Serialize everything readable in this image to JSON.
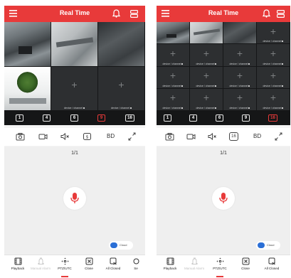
{
  "left": {
    "header": {
      "title": "Real Time"
    },
    "grid": [
      {
        "kind": "live",
        "label": "",
        "style": "cam-office"
      },
      {
        "kind": "live",
        "label": "",
        "style": "cam-bright"
      },
      {
        "kind": "live",
        "label": "",
        "style": "cam-dark"
      },
      {
        "kind": "live",
        "label": "",
        "style": "cam-plant"
      },
      {
        "kind": "empty",
        "label": "device / channel"
      },
      {
        "kind": "empty",
        "label": "device / channel"
      }
    ],
    "channels": [
      {
        "label": "1",
        "active": false
      },
      {
        "label": "4",
        "active": false
      },
      {
        "label": "6",
        "active": false
      },
      {
        "label": "9",
        "active": true
      },
      {
        "label": "16",
        "active": false
      }
    ],
    "toolbar": {
      "quality": "BD"
    },
    "page_indicator": "1/1",
    "toggle_label": "Cloud",
    "nav": [
      {
        "label": "Playback",
        "icon": "playback-icon",
        "disabled": false
      },
      {
        "label": "Manual Alarm",
        "icon": "alarm-icon",
        "disabled": true
      },
      {
        "label": "PTZ/UTC",
        "icon": "ptz-icon",
        "disabled": false
      },
      {
        "label": "Close",
        "icon": "close-icon",
        "disabled": false
      },
      {
        "label": "All Closed",
        "icon": "all-closed-icon",
        "disabled": false
      },
      {
        "label": "Se",
        "icon": "settings-icon",
        "disabled": false
      }
    ]
  },
  "right": {
    "header": {
      "title": "Real Time"
    },
    "grid": [
      {
        "kind": "live",
        "label": "",
        "style": "cam-office"
      },
      {
        "kind": "live",
        "label": "",
        "style": "cam-bright"
      },
      {
        "kind": "live",
        "label": "",
        "style": "cam-dark"
      },
      {
        "kind": "empty",
        "label": "device / channel"
      },
      {
        "kind": "empty",
        "label": "device / channel"
      },
      {
        "kind": "empty",
        "label": "device / channel"
      },
      {
        "kind": "empty",
        "label": "device / channel"
      },
      {
        "kind": "empty",
        "label": "device / channel"
      },
      {
        "kind": "empty",
        "label": "device / channel"
      },
      {
        "kind": "empty",
        "label": "device / channel"
      },
      {
        "kind": "empty",
        "label": "device / channel"
      },
      {
        "kind": "empty",
        "label": "device / channel"
      },
      {
        "kind": "empty",
        "label": "device / channel"
      },
      {
        "kind": "empty",
        "label": "device / channel"
      },
      {
        "kind": "empty",
        "label": "device / channel"
      },
      {
        "kind": "empty",
        "label": "device / channel"
      }
    ],
    "channels": [
      {
        "label": "1",
        "active": false
      },
      {
        "label": "4",
        "active": false
      },
      {
        "label": "6",
        "active": false
      },
      {
        "label": "9",
        "active": false
      },
      {
        "label": "16",
        "active": true
      }
    ],
    "toolbar": {
      "split": "16",
      "quality": "BD"
    },
    "page_indicator": "1/1",
    "toggle_label": "Cloud",
    "nav": [
      {
        "label": "Playback",
        "icon": "playback-icon",
        "disabled": false
      },
      {
        "label": "Manual Alarm",
        "icon": "alarm-icon",
        "disabled": true
      },
      {
        "label": "PTZ/UTC",
        "icon": "ptz-icon",
        "disabled": false
      },
      {
        "label": "Close",
        "icon": "close-icon",
        "disabled": false
      },
      {
        "label": "All Closed",
        "icon": "all-closed-icon",
        "disabled": false
      }
    ]
  },
  "colors": {
    "accent": "#e83a3a",
    "toggle": "#2b6fd6",
    "mic": "#e83a3a"
  }
}
